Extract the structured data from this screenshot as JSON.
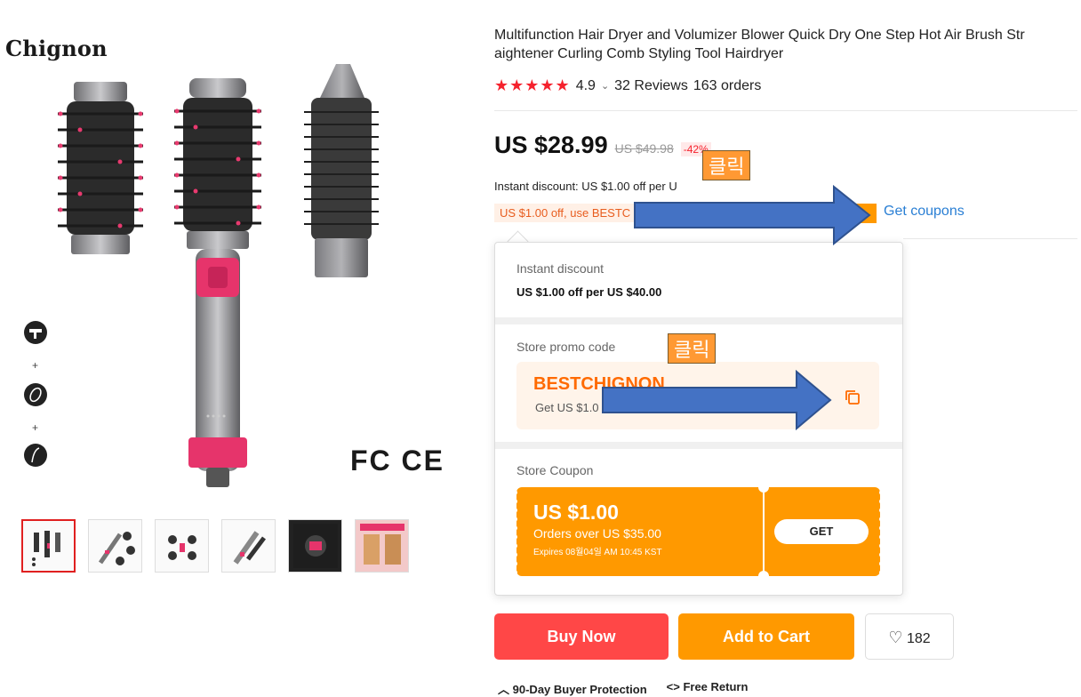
{
  "brand": "Chignon",
  "product": {
    "title": "Multifunction Hair Dryer and Volumizer Blower Quick Dry One Step Hot Air Brush Straightener Curling Comb Styling Tool Hairdryer",
    "title_line1": "Multifunction Hair Dryer and Volumizer Blower Quick Dry One Step Hot Air Brush Str",
    "title_line2": "aightener Curling Comb Styling Tool Hairdryer",
    "stars": "★★★★★",
    "rating": "4.9",
    "reviews": "32 Reviews",
    "orders": "163 orders",
    "certs": "FC CE"
  },
  "price": {
    "current": "US $28.99",
    "original": "US $49.98",
    "discount": "-42%"
  },
  "instant_discount_line": "Instant discount: US $1.00 off per U",
  "promo_strip": "US $1.00 off, use BESTC",
  "get_coupons": "Get coupons",
  "popup": {
    "instant_label": "Instant discount",
    "instant_value": "US $1.00 off per US $40.00",
    "promo_label": "Store promo code",
    "promo_code": "BESTCHIGNON",
    "promo_desc": "Get US $1.0",
    "coupon_label": "Store Coupon",
    "coupon_amount": "US $1.00",
    "coupon_orders": "Orders over US $35.00",
    "coupon_expiry": "Expires 08월04일 AM 10:45 KST",
    "get_label": "GET"
  },
  "annotations": [
    "클릭",
    "클릭"
  ],
  "actions": {
    "buy_now": "Buy Now",
    "add_to_cart": "Add to Cart",
    "wishlist_count": "182"
  },
  "bottom": {
    "protection": "90-Day Buyer Protection",
    "return": "Free Return"
  },
  "thumbnails": 6,
  "colors": {
    "accent_red": "#ff4747",
    "accent_orange": "#ff9900",
    "link_blue": "#2a7fd4",
    "arrow_blue": "#4472c4",
    "annotation_orange": "#ff9933"
  }
}
